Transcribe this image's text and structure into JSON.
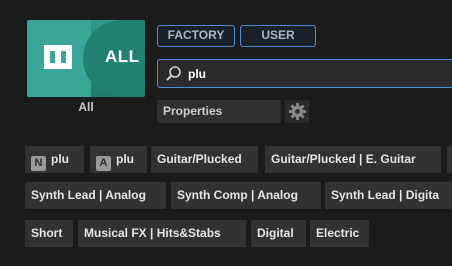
{
  "category": {
    "tile_label": "ALL",
    "caption": "All",
    "tile_color": "#2f9a8b"
  },
  "tabs": [
    {
      "label": "FACTORY"
    },
    {
      "label": "USER"
    }
  ],
  "search": {
    "value": "plu",
    "accent_color": "#4c8fd9"
  },
  "properties": {
    "label": "Properties",
    "settings_icon": "gear-icon"
  },
  "tags": {
    "row1": [
      {
        "badge": "N",
        "label": "plu"
      },
      {
        "badge": "A",
        "label": "plu"
      },
      {
        "label": "Guitar/Plucked"
      },
      {
        "label": "Guitar/Plucked | E. Guitar"
      }
    ],
    "row2": [
      {
        "label": "Synth Lead | Analog"
      },
      {
        "label": "Synth Comp | Analog"
      },
      {
        "label": "Synth Lead | Digita"
      }
    ],
    "row3": [
      {
        "label": "Short"
      },
      {
        "label": "Musical FX | Hits&Stabs"
      },
      {
        "label": "Digital"
      },
      {
        "label": "Electric"
      }
    ]
  }
}
